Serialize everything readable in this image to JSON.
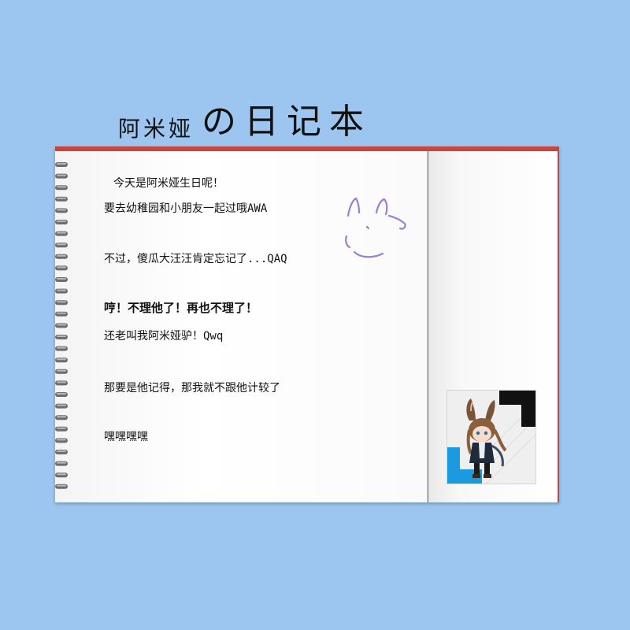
{
  "title": {
    "small": "阿米娅",
    "big": "の日记本"
  },
  "diary": {
    "lines": [
      "今天是阿米娅生日呢！",
      "要去幼稚园和小朋友一起过哦AWA",
      "不过，傻瓜大汪汪肯定忘记了...QAQ",
      "哼！不理他了！再也不理了！",
      "还老叫我阿米娅驴！Qwq",
      "那要是他记得，那我就不跟他计较了",
      "嘿嘿嘿嘿"
    ]
  },
  "colors": {
    "background": "#9cc6ef",
    "cover": "#c9463e",
    "doodle": "#9a7fd6",
    "accent_blue": "#1a9be0"
  },
  "icons": {
    "doodle": "rabbit-doodle-icon",
    "photo": "chibi-character-sticker"
  }
}
